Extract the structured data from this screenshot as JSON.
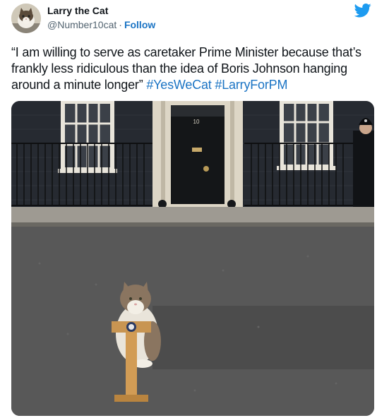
{
  "tweet": {
    "display_name": "Larry the Cat",
    "handle": "@Number10cat",
    "separator": "·",
    "follow_label": "Follow",
    "text_quote": "“I am willing to serve as caretaker Prime Minister because that’s frankly less ridiculous than the idea of Boris Johnson hanging around a minute longer”",
    "hashtags": [
      "#YesWeCat",
      "#LarryForPM"
    ],
    "door_number": "10"
  },
  "icons": {
    "brand": "twitter-bird-icon",
    "avatar": "cat-avatar"
  },
  "colors": {
    "link": "#1b74c4",
    "brand": "#1d9bf0",
    "text": "#0f1419",
    "muted": "#536471"
  }
}
